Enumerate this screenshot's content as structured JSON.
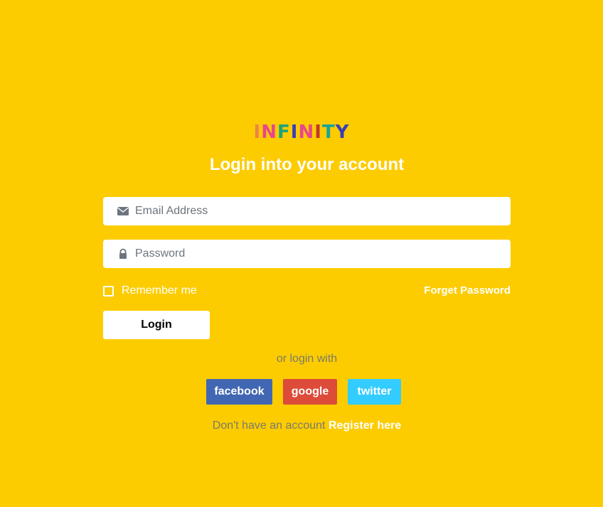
{
  "logo": {
    "text": "INFINITY",
    "letters": [
      {
        "char": "I",
        "color": "#f0824b"
      },
      {
        "char": "N",
        "color": "#e8478b"
      },
      {
        "char": "F",
        "color": "#1fa37a"
      },
      {
        "char": "I",
        "color": "#3b3fb5"
      },
      {
        "char": "N",
        "color": "#e8478b"
      },
      {
        "char": "I",
        "color": "#c0392b"
      },
      {
        "char": "T",
        "color": "#1aa39a"
      },
      {
        "char": "Y",
        "color": "#3b3fb5"
      }
    ]
  },
  "title": "Login into your account",
  "email": {
    "placeholder": "Email Address",
    "value": "",
    "icon": "envelope-icon"
  },
  "password": {
    "placeholder": "Password",
    "value": "",
    "icon": "lock-icon"
  },
  "remember": {
    "label": "Remember me",
    "checked": false
  },
  "forget_password": "Forget Password",
  "login_button": "Login",
  "or_login_with": "or login with",
  "social": {
    "facebook": {
      "label": "facebook",
      "color": "#4267b2"
    },
    "google": {
      "label": "google",
      "color": "#dd4b39"
    },
    "twitter": {
      "label": "twitter",
      "color": "#33ccff"
    }
  },
  "register": {
    "prompt": "Don't have an account",
    "link": "Register here"
  },
  "colors": {
    "background": "#fccc00",
    "white": "#ffffff",
    "muted_text": "#7a7a6a"
  }
}
